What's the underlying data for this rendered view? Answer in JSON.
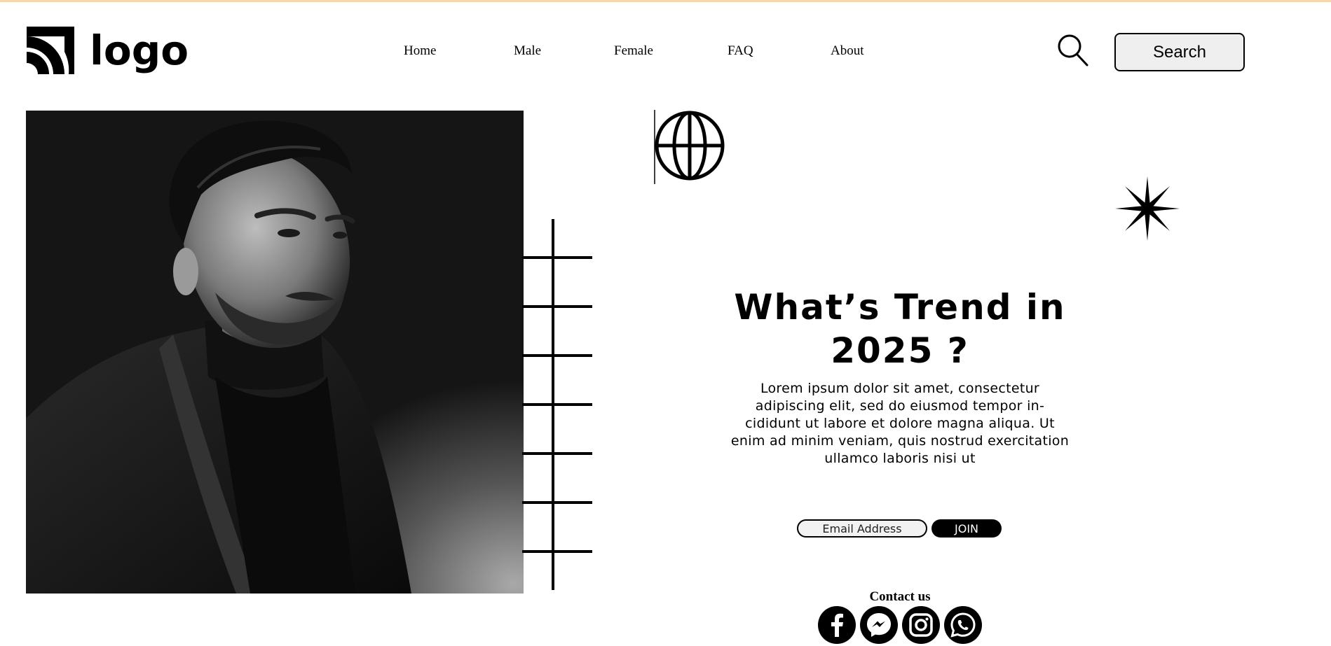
{
  "header": {
    "logo_text": "logo",
    "nav": [
      {
        "label": "Home"
      },
      {
        "label": "Male"
      },
      {
        "label": "Female"
      },
      {
        "label": "FAQ"
      },
      {
        "label": "About"
      }
    ],
    "search_label": "Search"
  },
  "hero": {
    "headline_line1": "What’s Trend in",
    "headline_line2": "2025 ?",
    "body": "Lorem ipsum dolor sit amet, consectetur adipiscing elit, sed do eiusmod tempor in-cididunt ut labore et dolore magna aliqua. Ut enim ad minim veniam, quis nostrud exercitation ullamco laboris nisi ut",
    "email_placeholder": "Email Address",
    "join_label": "JOIN"
  },
  "contact": {
    "title": "Contact us",
    "icons": [
      "facebook-icon",
      "messenger-icon",
      "instagram-icon",
      "whatsapp-icon"
    ]
  },
  "colors": {
    "accent": "#000000",
    "top_strip": "#f3d8ae",
    "button_bg": "#efefef"
  }
}
